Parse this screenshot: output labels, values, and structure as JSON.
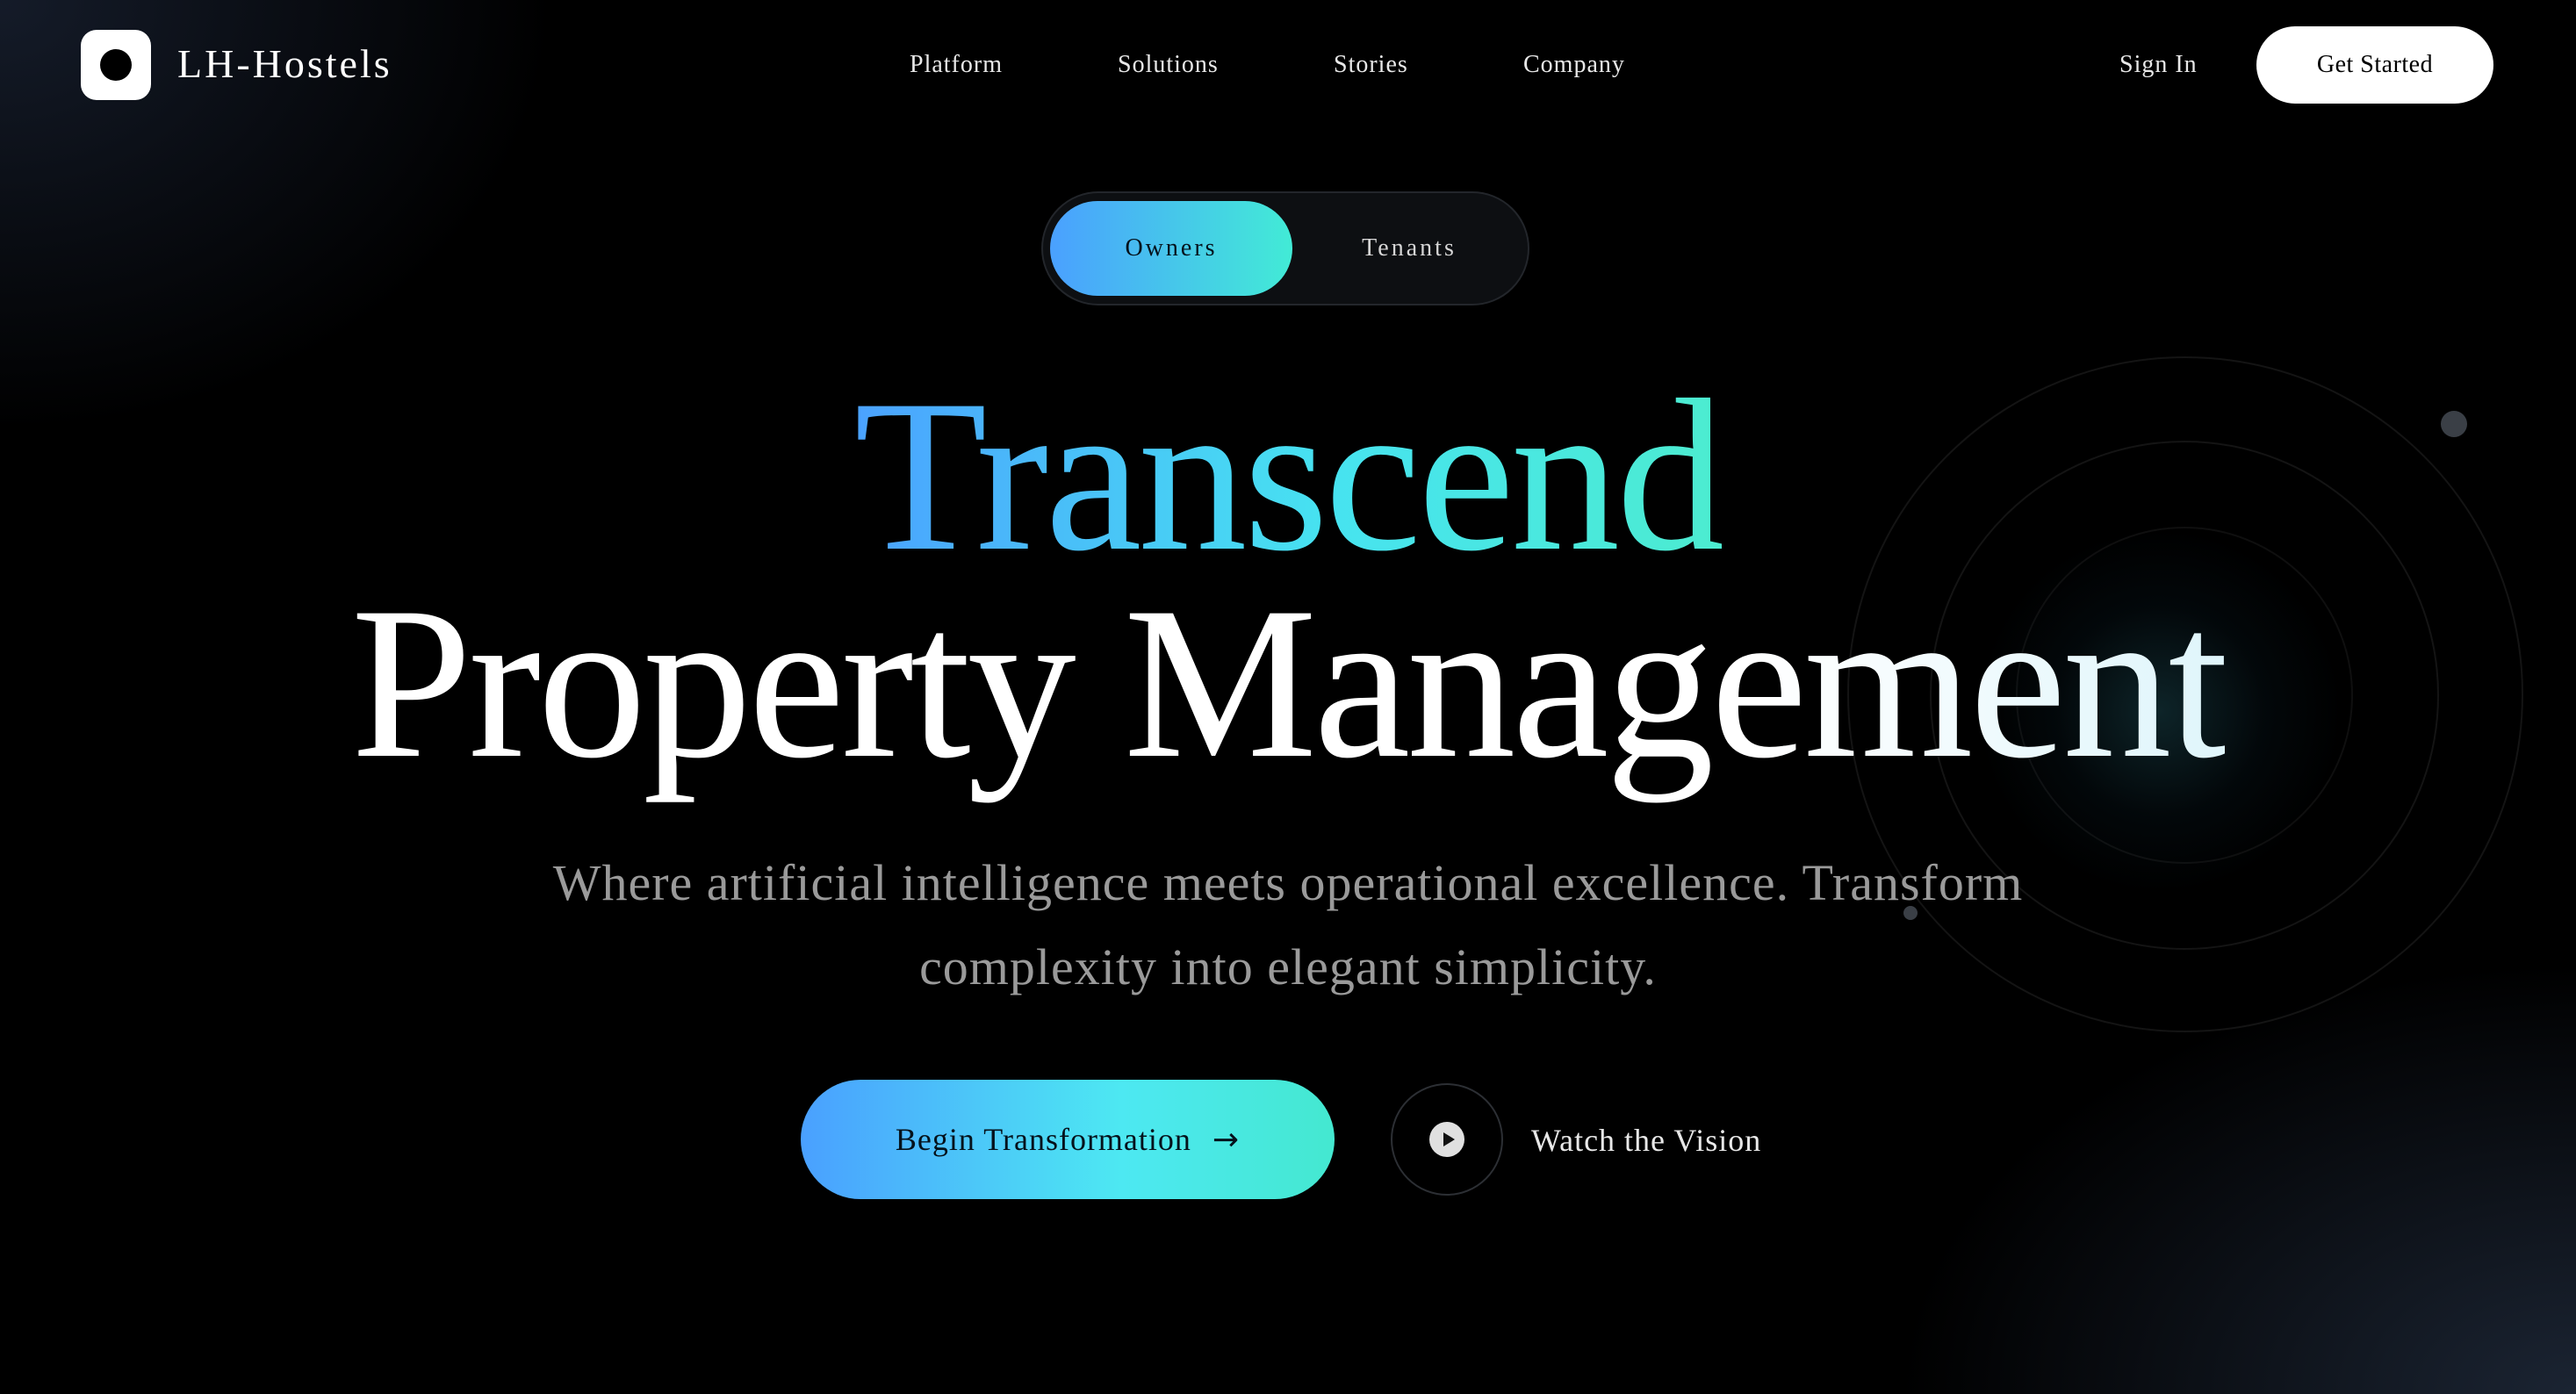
{
  "brand": {
    "name": "LH-Hostels",
    "logo_icon": "rounded-square-dot-icon"
  },
  "nav": {
    "links": [
      "Platform",
      "Solutions",
      "Stories",
      "Company"
    ],
    "sign_in": "Sign In",
    "get_started": "Get Started"
  },
  "toggle": {
    "options": [
      "Owners",
      "Tenants"
    ],
    "selected": "Owners"
  },
  "hero": {
    "headline_line1": "Transcend",
    "headline_line2": "Property Management",
    "subtitle_line1": "Where artificial intelligence meets operational excellence. Transform",
    "subtitle_line2": "complexity into elegant simplicity."
  },
  "cta": {
    "primary_label": "Begin Transformation",
    "primary_arrow": "→",
    "secondary_label": "Watch the Vision",
    "secondary_icon": "play-icon"
  },
  "colors": {
    "background": "#000000",
    "gradient_start": "#4aa0ff",
    "gradient_end": "#42ebd6",
    "text_muted": "#9a9a9a"
  }
}
